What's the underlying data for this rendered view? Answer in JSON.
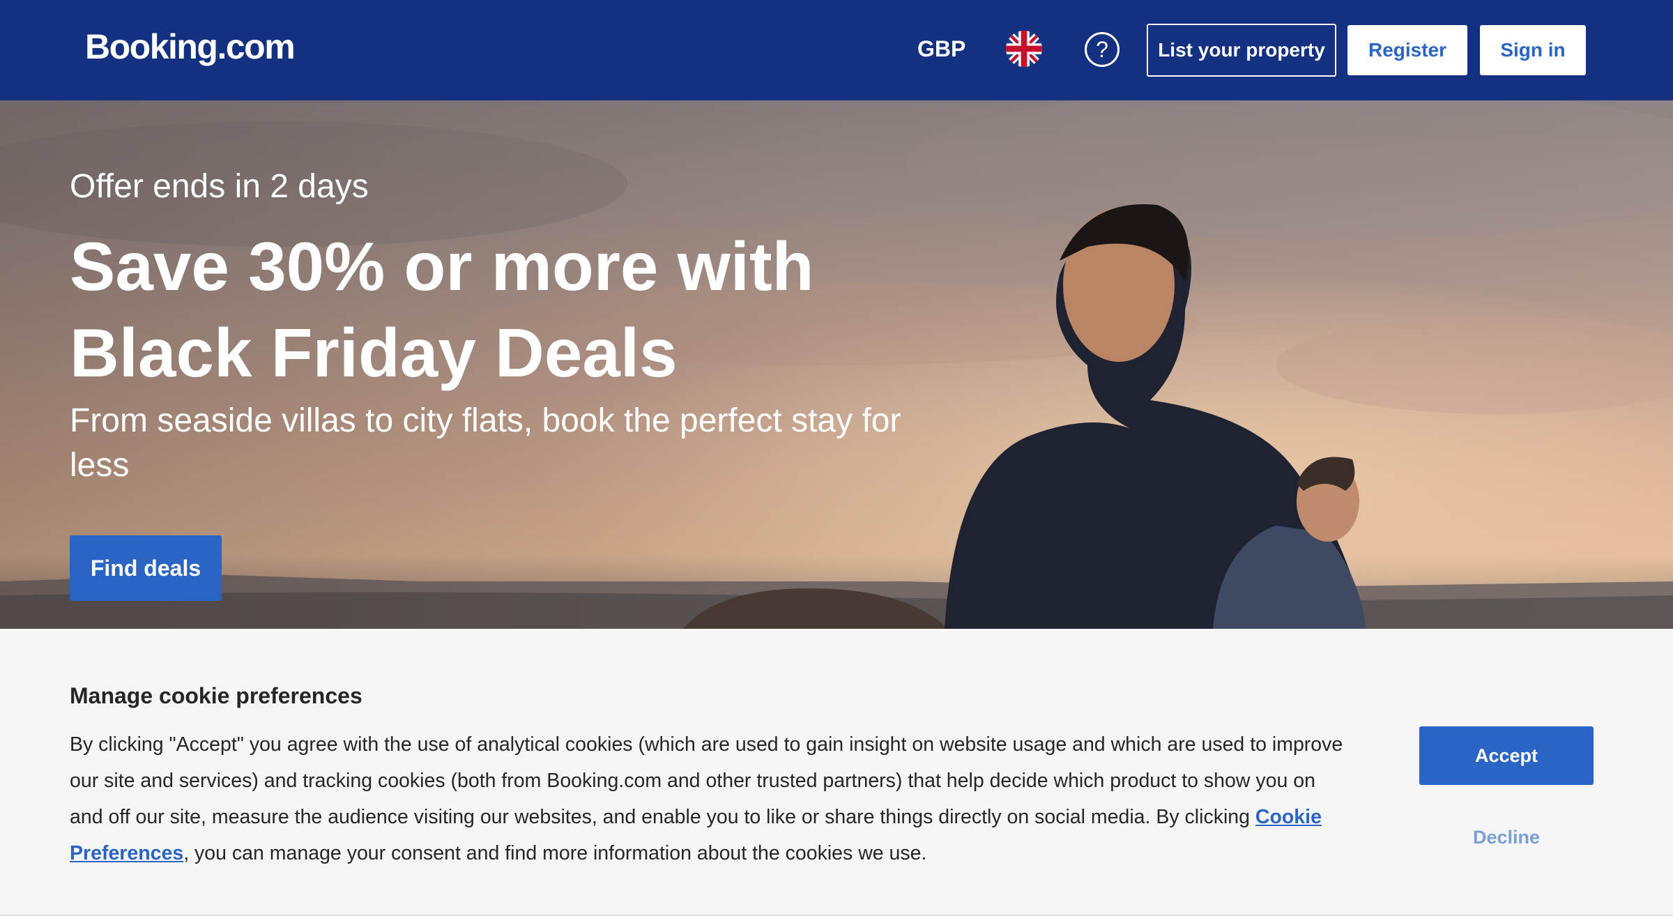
{
  "header": {
    "logo": "Booking.com",
    "currency": "GBP",
    "language_icon": "uk-flag-icon",
    "help_icon": "help-icon",
    "list_property_label": "List your property",
    "register_label": "Register",
    "signin_label": "Sign in"
  },
  "hero": {
    "offer_text": "Offer ends in 2 days",
    "headline": "Save 30% or more with Black Friday Deals",
    "subline": "From seaside villas to city flats, book the perfect stay for less",
    "cta_label": "Find deals"
  },
  "cookie_banner": {
    "title": "Manage cookie preferences",
    "text_before_link": "By clicking \"Accept\" you agree with the use of analytical cookies (which are used to gain insight on website usage and which are used to improve our site and services) and tracking cookies (both from Booking.com and other trusted partners) that help decide which product to show you on and off our site, measure the audience visiting our websites, and enable you to like or share things directly on social media. By clicking ",
    "link_text": "Cookie Preferences",
    "text_after_link": ", you can manage your consent and find more information about the cookies we use.",
    "accept_label": "Accept",
    "decline_label": "Decline"
  },
  "colors": {
    "header_bg": "#143181",
    "primary_blue": "#2a64c5",
    "banner_bg": "#f5f5f5"
  }
}
